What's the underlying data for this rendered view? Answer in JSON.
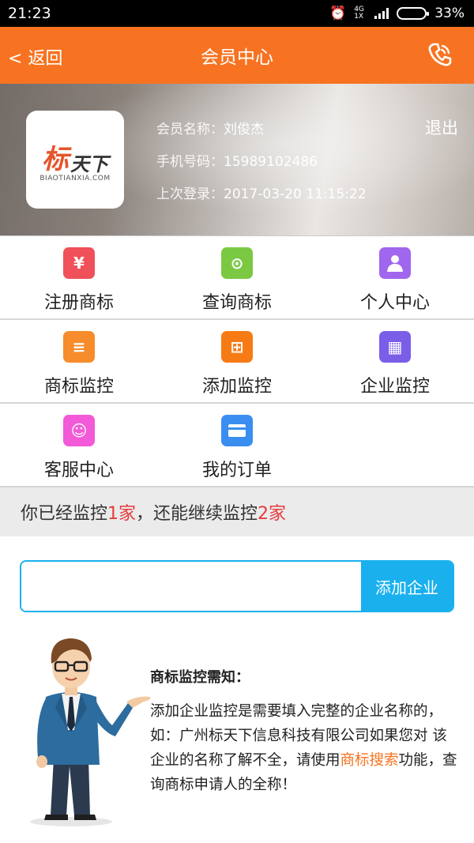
{
  "status_bar": {
    "time": "21:23",
    "network": "4G 1X",
    "battery": "33%",
    "battery_level": 0.33
  },
  "header": {
    "back_label": "< 返回",
    "title": "会员中心"
  },
  "profile": {
    "logo_text_main": "标",
    "logo_text_sub": "天下",
    "logo_domain": "BIAOTIANXIA.COM",
    "name_label": "会员名称：",
    "name_value": "刘俊杰",
    "phone_label": "手机号码：",
    "phone_value": "15989102486",
    "last_login_label": "上次登录：",
    "last_login_value": "2017-03-20 11:15:22",
    "logout_label": "退出"
  },
  "menu": [
    {
      "label": "注册商标",
      "icon": "trademark-register-icon",
      "color": "#f0505a",
      "glyph": "¥"
    },
    {
      "label": "查询商标",
      "icon": "trademark-search-icon",
      "color": "#7bc943",
      "glyph": "⊙"
    },
    {
      "label": "个人中心",
      "icon": "person-icon",
      "color": "#a166ee",
      "glyph": "👤"
    },
    {
      "label": "商标监控",
      "icon": "trademark-monitor-icon",
      "color": "#f68c2c",
      "glyph": "≡"
    },
    {
      "label": "添加监控",
      "icon": "add-monitor-icon",
      "color": "#f77b15",
      "glyph": "⊞"
    },
    {
      "label": "企业监控",
      "icon": "enterprise-monitor-icon",
      "color": "#7a5ee8",
      "glyph": "▦"
    },
    {
      "label": "客服中心",
      "icon": "customer-service-icon",
      "color": "#f25ad8",
      "glyph": "☺"
    },
    {
      "label": "我的订单",
      "icon": "orders-icon",
      "color": "#3a8ef0",
      "glyph": "▭"
    }
  ],
  "notice": {
    "prefix": "你已经监控",
    "count_monitored": "1家",
    "middle": "，还能继续监控",
    "count_remaining": "2家"
  },
  "add_enterprise": {
    "input_value": "",
    "placeholder": "",
    "button_label": "添加企业"
  },
  "tips": {
    "title": "商标监控需知：",
    "body_before_link": "添加企业监控是需要填入完整的企业名称的，如：广州标天下信息科技有限公司如果您对 该企业的名称了解不全，请使用",
    "link_text": "商标搜索",
    "body_after_link": "功能，查询商标申请人的全称！"
  },
  "colors": {
    "accent": "#f77321",
    "button_blue": "#1ab0ee",
    "highlight_red": "#e53b3b"
  }
}
